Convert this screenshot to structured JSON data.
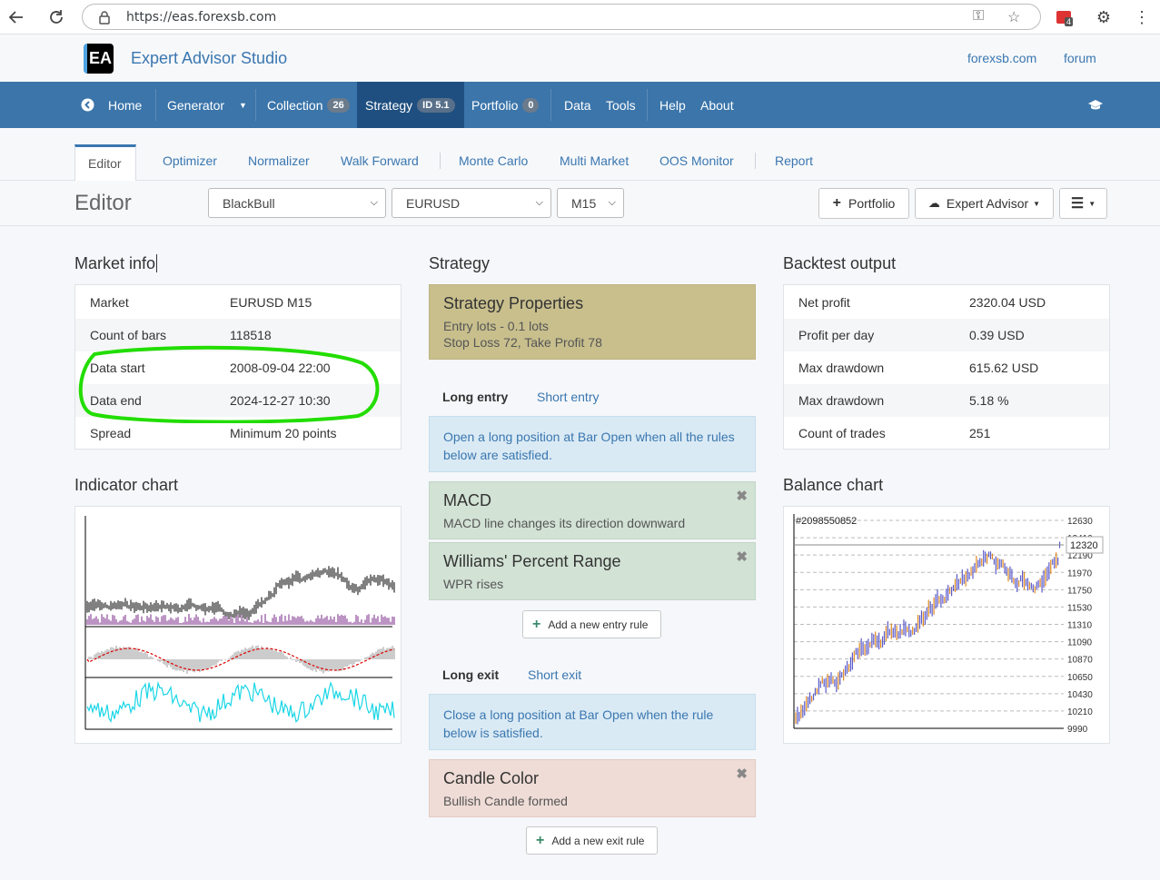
{
  "browser": {
    "url": "https://eas.forexsb.com",
    "ext_badge": "4"
  },
  "site": {
    "logo_text": "EA",
    "title": "Expert Advisor Studio",
    "links": [
      "forexsb.com",
      "forum"
    ]
  },
  "nav": {
    "home": "Home",
    "generator": "Generator",
    "collection": "Collection",
    "collection_count": "26",
    "strategy": "Strategy",
    "strategy_id": "ID 5.1",
    "portfolio": "Portfolio",
    "portfolio_count": "0",
    "data": "Data",
    "tools": "Tools",
    "help": "Help",
    "about": "About"
  },
  "tabs": [
    "Editor",
    "Optimizer",
    "Normalizer",
    "Walk Forward",
    "Monte Carlo",
    "Multi Market",
    "OOS Monitor",
    "Report"
  ],
  "toolbar": {
    "title": "Editor",
    "broker": "BlackBull",
    "symbol": "EURUSD",
    "period": "M15",
    "portfolio_btn": "Portfolio",
    "ea_btn": "Expert Advisor"
  },
  "market_info": {
    "title": "Market info",
    "rows": [
      {
        "k": "Market",
        "v": "EURUSD M15"
      },
      {
        "k": "Count of bars",
        "v": "118518"
      },
      {
        "k": "Data start",
        "v": "2008-09-04 22:00"
      },
      {
        "k": "Data end",
        "v": "2024-12-27 10:30"
      },
      {
        "k": "Spread",
        "v": "Minimum 20 points"
      }
    ]
  },
  "indicator_chart": {
    "title": "Indicator chart"
  },
  "strategy": {
    "title": "Strategy",
    "props_title": "Strategy Properties",
    "props_line1": "Entry lots - 0.1 lots",
    "props_line2": "Stop Loss 72, Take Profit 78",
    "long_entry": "Long entry",
    "short_entry": "Short entry",
    "entry_info": "Open a long position at Bar Open when all the rules below are satisfied.",
    "rules": [
      {
        "title": "MACD",
        "desc": "MACD line changes its direction downward"
      },
      {
        "title": "Williams' Percent Range",
        "desc": "WPR rises"
      }
    ],
    "add_entry": "Add a new entry rule",
    "long_exit": "Long exit",
    "short_exit": "Short exit",
    "exit_info": "Close a long position at Bar Open when the rule below is satisfied.",
    "exit_rule": {
      "title": "Candle Color",
      "desc": "Bullish Candle formed"
    },
    "add_exit": "Add a new exit rule"
  },
  "backtest": {
    "title": "Backtest output",
    "rows": [
      {
        "k": "Net profit",
        "v": "2320.04 USD"
      },
      {
        "k": "Profit per day",
        "v": "0.39 USD"
      },
      {
        "k": "Max drawdown",
        "v": "615.62 USD"
      },
      {
        "k": "Max drawdown",
        "v": "5.18 %"
      },
      {
        "k": "Count of trades",
        "v": "251"
      }
    ]
  },
  "balance_chart": {
    "title": "Balance chart",
    "label": "#2098550852",
    "current": "12320",
    "ticks": [
      "12630",
      "12410",
      "12190",
      "11970",
      "11750",
      "11530",
      "11310",
      "11090",
      "10870",
      "10650",
      "10430",
      "10210",
      "9990"
    ]
  },
  "colors": {
    "nav": "#3b75aa",
    "nav_active": "#1f4f80",
    "accent": "#3a77b0",
    "highlight": "#22dd00"
  }
}
